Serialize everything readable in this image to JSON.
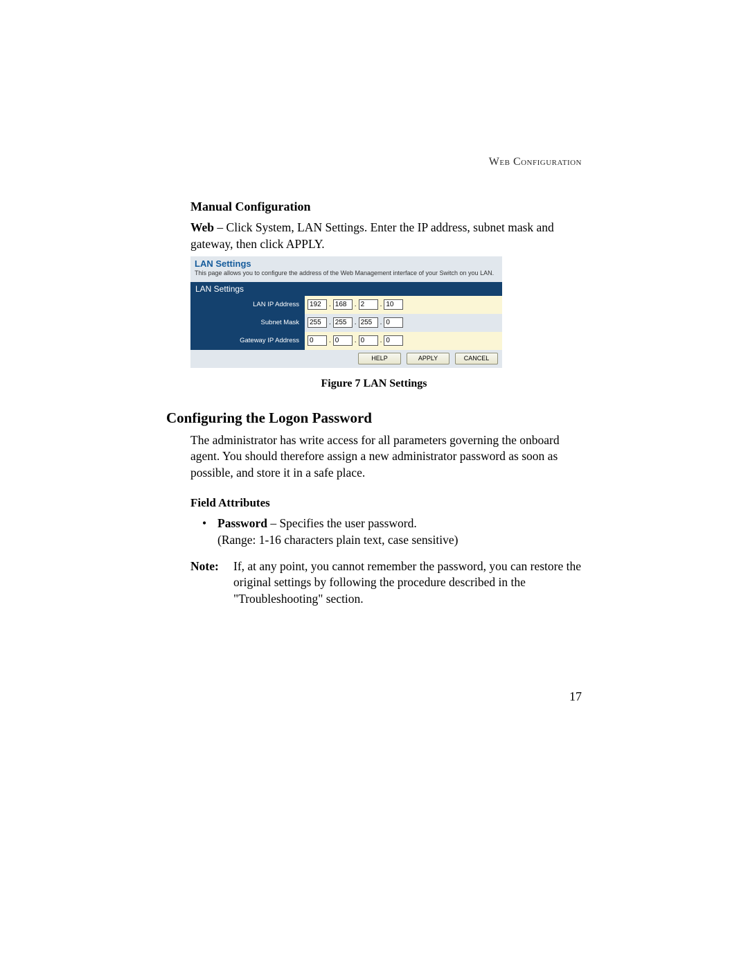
{
  "header": "Web Configuration",
  "section1": {
    "title": "Manual Configuration",
    "para_lead": "Web",
    "para_rest": " – Click System, LAN Settings. Enter the IP address, subnet mask and gateway, then click APPLY."
  },
  "panel": {
    "title": "LAN Settings",
    "desc": "This page allows you to configure the address of the Web Management interface of your Switch on you LAN.",
    "section_head": "LAN Settings",
    "rows": [
      {
        "label": "LAN IP Address",
        "oct": [
          "192",
          "168",
          "2",
          "10"
        ]
      },
      {
        "label": "Subnet Mask",
        "oct": [
          "255",
          "255",
          "255",
          "0"
        ]
      },
      {
        "label": "Gateway IP Address",
        "oct": [
          "0",
          "0",
          "0",
          "0"
        ]
      }
    ],
    "buttons": {
      "help": "HELP",
      "apply": "APPLY",
      "cancel": "CANCEL"
    }
  },
  "fig_caption": "Figure 7  LAN Settings",
  "section2": {
    "title": "Configuring the Logon Password",
    "para": "The administrator has write access for all parameters governing the onboard agent. You should therefore assign a new administrator password as soon as possible, and store it in a safe place.",
    "field_attr_head": "Field Attributes",
    "bullet_lead": "Password",
    "bullet_rest": " – Specifies the user password.",
    "bullet_line2": "(Range: 1-16 characters plain text, case sensitive)",
    "note_label": "Note:",
    "note_body": "If, at any point, you cannot remember the password, you can restore the original settings by following the procedure described in the \"Troubleshooting\" section."
  },
  "page_num": "17"
}
